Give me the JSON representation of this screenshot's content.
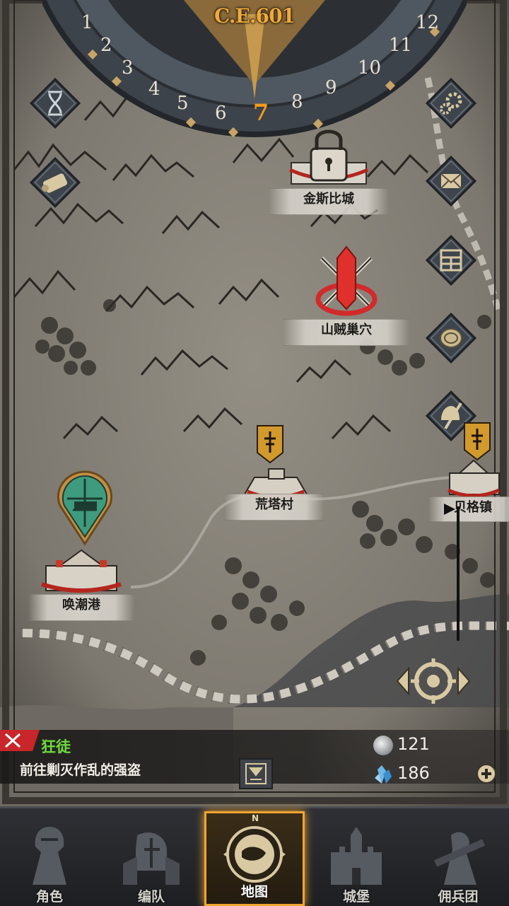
{
  "calendar": {
    "era": "C.E.601",
    "months": [
      "1",
      "2",
      "3",
      "4",
      "5",
      "6",
      "7",
      "8",
      "9",
      "10",
      "11",
      "12"
    ],
    "current_month": "7"
  },
  "locations": [
    {
      "name": "金斯比城",
      "status": "locked"
    },
    {
      "name": "山贼巢穴",
      "status": "enemy"
    },
    {
      "name": "荒塔村"
    },
    {
      "name": "贝格镇"
    },
    {
      "name": "唤潮港",
      "status": "current"
    }
  ],
  "quest": {
    "title": "狂徒",
    "description": "前往剿灭作乱的强盗"
  },
  "resources": {
    "silver": "121",
    "crystal": "186"
  },
  "nav_compass": "N",
  "nav": [
    "角色",
    "编队",
    "地图",
    "城堡",
    "佣兵团"
  ],
  "active_tab": "地图",
  "icons": {
    "left_buttons": [
      "hourglass-icon",
      "scroll-icon"
    ],
    "right_buttons": [
      "gear-icon",
      "envelope-icon",
      "board-icon",
      "coin-icon",
      "helmet-sword-icon"
    ]
  },
  "colors": {
    "accent": "#f0a531",
    "quest_title": "#6fdc3e",
    "enemy_marker": "#e0302c",
    "player_marker": "#3f9b7e"
  }
}
